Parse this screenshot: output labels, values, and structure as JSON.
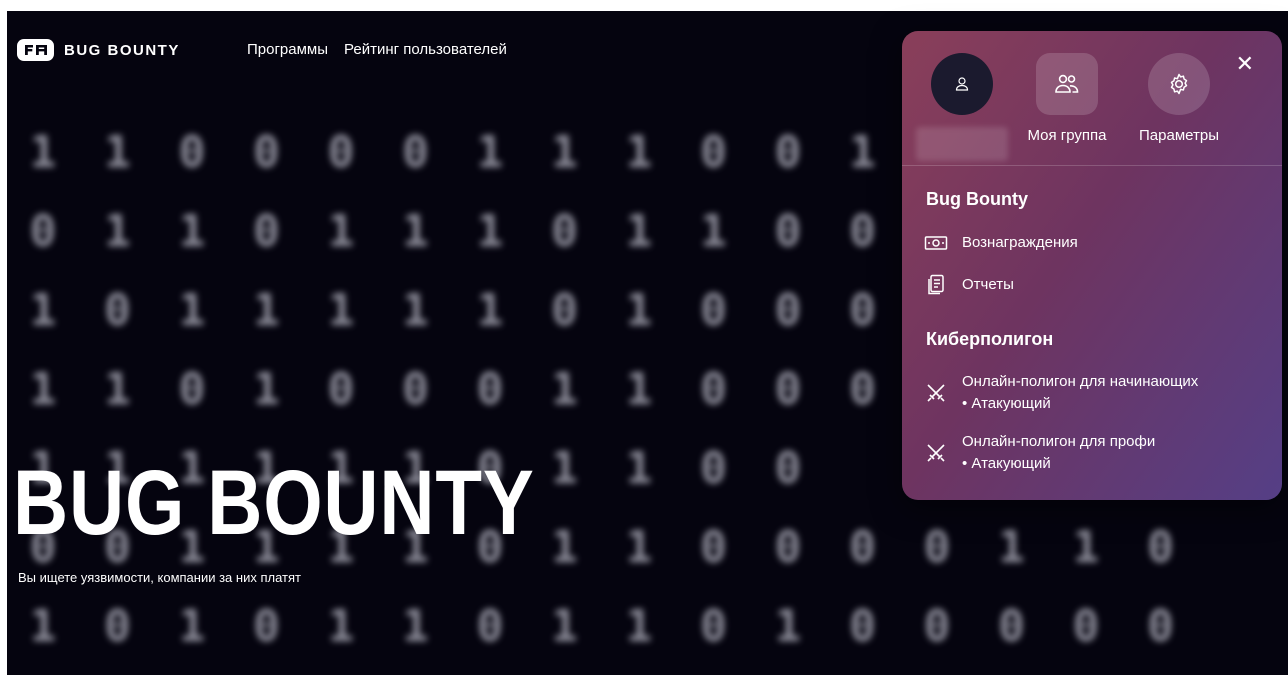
{
  "header": {
    "logo_text": "BUG BOUNTY",
    "nav": [
      "Программы",
      "Рейтинг пользователей"
    ]
  },
  "hero": {
    "title": "BUG BOUNTY",
    "subtitle": "Вы ищете уязвимости, компании за них платят"
  },
  "background_digits": [
    "110000111001",
    "011011101100",
    "101111101000",
    "110100011000",
    "11111101100",
    "0011110110000110",
    "1010110110100000"
  ],
  "panel": {
    "quick_actions": [
      {
        "label": "",
        "icon": "user-icon"
      },
      {
        "label": "Моя группа",
        "icon": "group-icon"
      },
      {
        "label": "Параметры",
        "icon": "gear-icon"
      }
    ],
    "sections": [
      {
        "title": "Bug Bounty",
        "items": [
          {
            "label": "Вознаграждения",
            "sub": "",
            "icon": "money-icon"
          },
          {
            "label": "Отчеты",
            "sub": "",
            "icon": "report-icon"
          }
        ]
      },
      {
        "title": "Киберполигон",
        "items": [
          {
            "label": "Онлайн-полигон для начинающих",
            "sub": "• Атакующий",
            "icon": "swords-icon"
          },
          {
            "label": "Онлайн-полигон для профи",
            "sub": "• Атакующий",
            "icon": "swords-icon"
          }
        ]
      }
    ],
    "close_symbol": "✕"
  },
  "colors": {
    "background": "#05040f",
    "panel_gradient_start": "#8a3f5a",
    "panel_gradient_end": "#553f86"
  }
}
